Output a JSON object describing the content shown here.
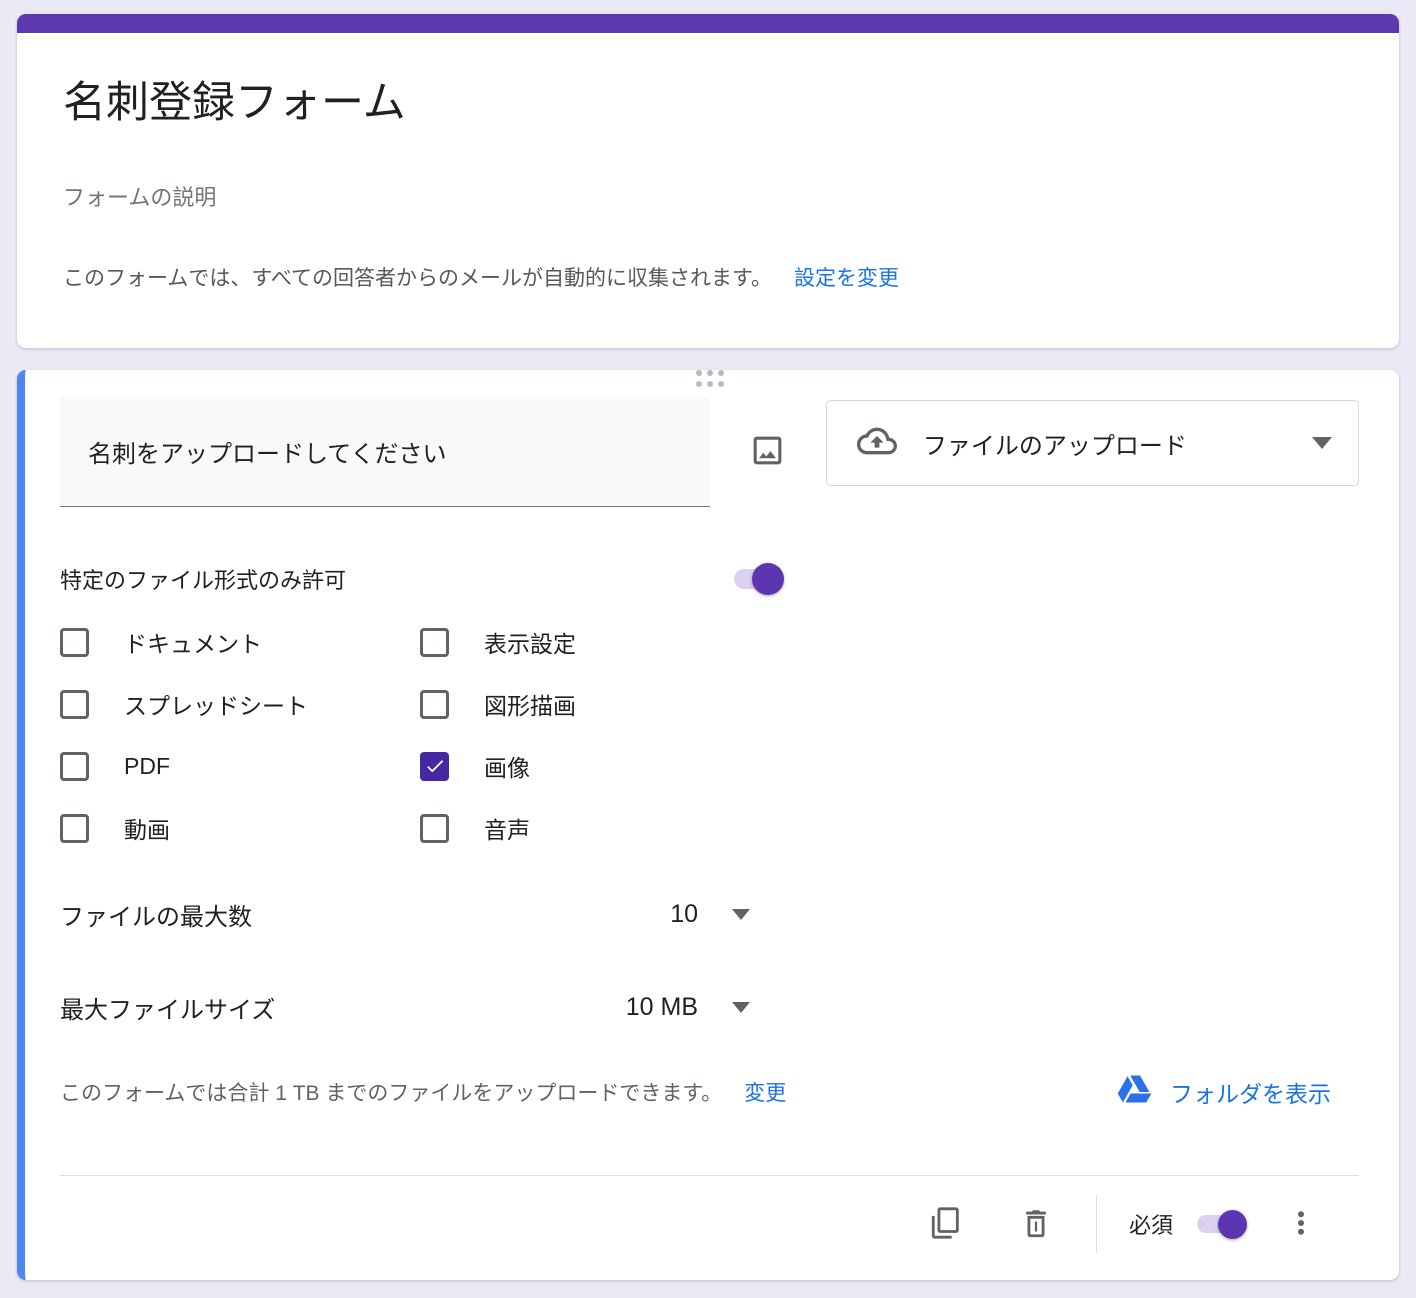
{
  "theme": {
    "header_bar_color": "#5e39ad",
    "question_accent_color": "#4d86f0",
    "toggle_on_color": "#5e35b1",
    "checkbox_checked_color": "#4527a0",
    "link_color": "#1a73e8",
    "drive_icon_color": "#2a70ea",
    "background_color": "#ece9f6"
  },
  "header_card": {
    "title": "名刺登録フォーム",
    "description_placeholder": "フォームの説明",
    "email_notice": "このフォームでは、すべての回答者からのメールが自動的に収集されます。",
    "email_settings_link": "設定を変更"
  },
  "question_card": {
    "title": "名刺をアップロードしてください",
    "type_selector": {
      "selected": "ファイルのアップロード",
      "icon": "cloud-upload-icon"
    },
    "allow_specific_types": {
      "label": "特定のファイル形式のみ許可",
      "enabled": true
    },
    "file_types": [
      {
        "label": "ドキュメント",
        "checked": false
      },
      {
        "label": "表示設定",
        "checked": false
      },
      {
        "label": "スプレッドシート",
        "checked": false
      },
      {
        "label": "図形描画",
        "checked": false
      },
      {
        "label": "PDF",
        "checked": false
      },
      {
        "label": "画像",
        "checked": true
      },
      {
        "label": "動画",
        "checked": false
      },
      {
        "label": "音声",
        "checked": false
      }
    ],
    "max_files": {
      "label": "ファイルの最大数",
      "value": "10"
    },
    "max_file_size": {
      "label": "最大ファイルサイズ",
      "value": "10 MB"
    },
    "storage_notice": "このフォームでは合計 1 TB までのファイルをアップロードできます。",
    "storage_change_link": "変更",
    "view_folder_link": "フォルダを表示",
    "footer": {
      "required_label": "必須",
      "required_enabled": true
    }
  }
}
